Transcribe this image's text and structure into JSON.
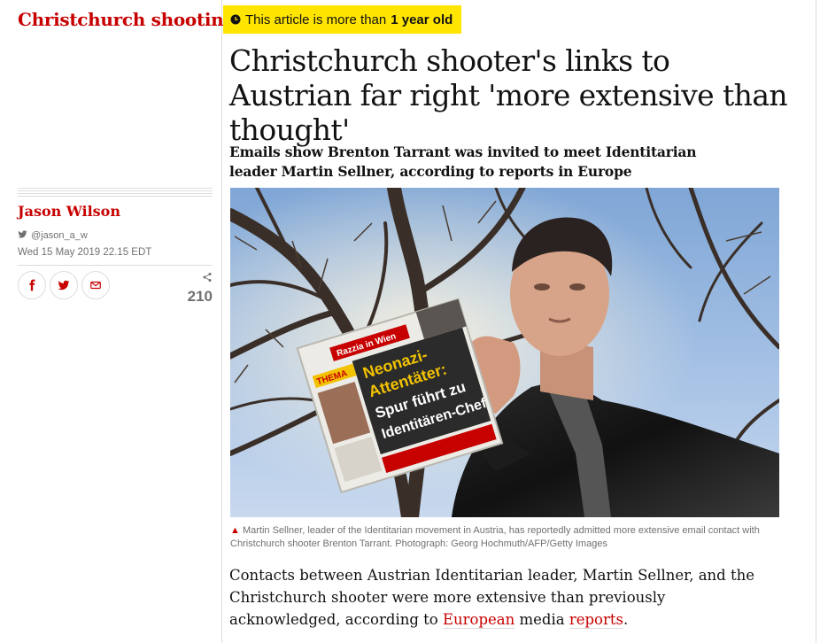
{
  "section": {
    "kicker": "Christchurch shooting"
  },
  "notice": {
    "prefix": "This article is more than ",
    "bold": "1 year old",
    "icon": "clock-icon"
  },
  "article": {
    "headline": "Christchurch shooter's links to Austrian far right 'more extensive than thought'",
    "standfirst": "Emails show Brenton Tarrant was invited to meet Identitarian leader Martin Sellner, according to reports in Europe",
    "body": {
      "pre": "Contacts between Austrian Identitarian leader, Martin Sellner, and the Christchurch shooter were more extensive than previously acknowledged, according to ",
      "link1": "European",
      "mid": " media ",
      "link2": "reports",
      "post": "."
    }
  },
  "byline": {
    "author": "Jason Wilson",
    "twitter": "@jason_a_w",
    "date": "Wed 15 May 2019 22.15 EDT"
  },
  "share": {
    "count": "210",
    "buttons": [
      "facebook-icon",
      "twitter-icon",
      "email-icon"
    ]
  },
  "newspaper": {
    "tag1": "Razzia in Wien",
    "tag2": "THEMA",
    "line1": "Neonazi-",
    "line2": "Attentäter:",
    "line3": "Spur führt zu",
    "line4": "Identitären-Chef"
  },
  "caption": {
    "text": "Martin Sellner, leader of the Identitarian movement in Austria, has reportedly admitted more extensive email contact with Christchurch shooter Brenton Tarrant. Photograph: Georg Hochmuth/AFP/Getty Images"
  },
  "colors": {
    "accent": "#c70000",
    "badge": "#ffe500",
    "meta": "#707070"
  }
}
